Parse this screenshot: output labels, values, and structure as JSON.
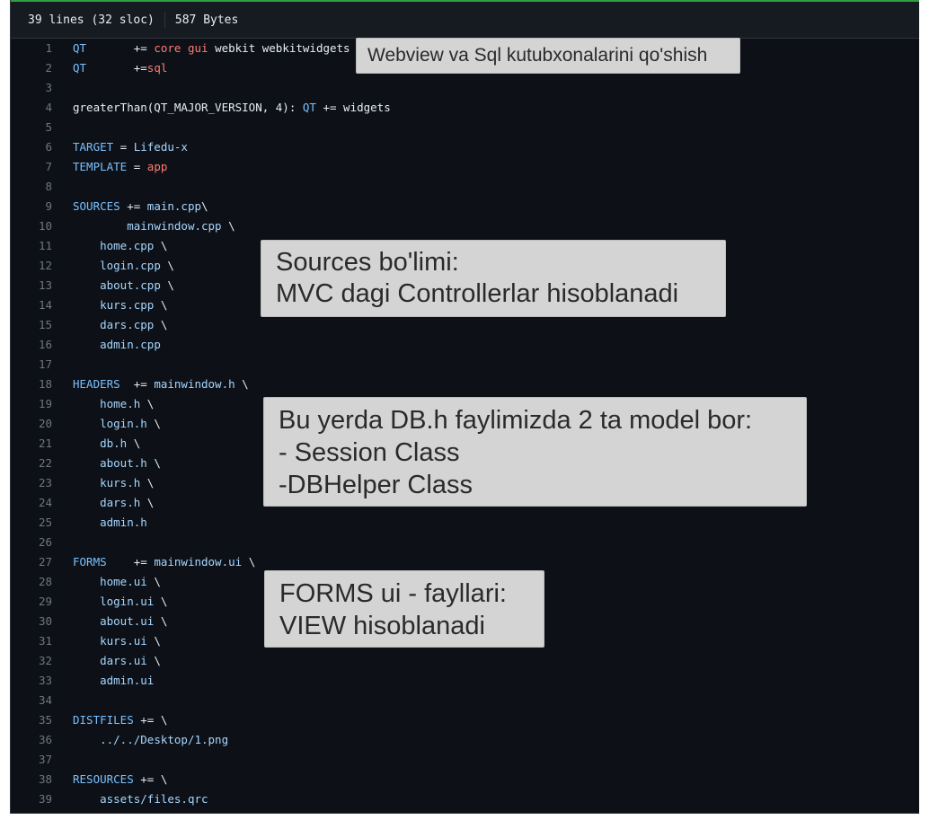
{
  "header": {
    "lines_info": "39 lines (32 sloc)",
    "size": "587 Bytes"
  },
  "code_lines": [
    {
      "n": "1",
      "t": [
        {
          "t": "QT",
          "c": "k"
        },
        {
          "t": "       += "
        },
        {
          "t": "core",
          "c": "r"
        },
        {
          "t": " "
        },
        {
          "t": "gui",
          "c": "r"
        },
        {
          "t": " webkit webkitwidgets"
        }
      ]
    },
    {
      "n": "2",
      "t": [
        {
          "t": "QT",
          "c": "k"
        },
        {
          "t": "       +="
        },
        {
          "t": "sql",
          "c": "r"
        }
      ]
    },
    {
      "n": "3",
      "t": []
    },
    {
      "n": "4",
      "t": [
        {
          "t": "greaterThan(QT_MAJOR_VERSION, 4): "
        },
        {
          "t": "QT",
          "c": "k"
        },
        {
          "t": " += widgets"
        }
      ]
    },
    {
      "n": "5",
      "t": []
    },
    {
      "n": "6",
      "t": [
        {
          "t": "TARGET",
          "c": "k"
        },
        {
          "t": " = "
        },
        {
          "t": "Lifedu-x",
          "c": "a"
        }
      ]
    },
    {
      "n": "7",
      "t": [
        {
          "t": "TEMPLATE",
          "c": "k"
        },
        {
          "t": " = "
        },
        {
          "t": "app",
          "c": "r"
        }
      ]
    },
    {
      "n": "8",
      "t": []
    },
    {
      "n": "9",
      "t": [
        {
          "t": "SOURCES",
          "c": "k"
        },
        {
          "t": " += "
        },
        {
          "t": "main.cpp",
          "c": "a"
        },
        {
          "t": "\\"
        }
      ]
    },
    {
      "n": "10",
      "t": [
        {
          "t": "        "
        },
        {
          "t": "mainwindow.cpp",
          "c": "a"
        },
        {
          "t": " \\"
        }
      ]
    },
    {
      "n": "11",
      "t": [
        {
          "t": "    "
        },
        {
          "t": "home.cpp",
          "c": "a"
        },
        {
          "t": " \\"
        }
      ]
    },
    {
      "n": "12",
      "t": [
        {
          "t": "    "
        },
        {
          "t": "login.cpp",
          "c": "a"
        },
        {
          "t": " \\"
        }
      ]
    },
    {
      "n": "13",
      "t": [
        {
          "t": "    "
        },
        {
          "t": "about.cpp",
          "c": "a"
        },
        {
          "t": " \\"
        }
      ]
    },
    {
      "n": "14",
      "t": [
        {
          "t": "    "
        },
        {
          "t": "kurs.cpp",
          "c": "a"
        },
        {
          "t": " \\"
        }
      ]
    },
    {
      "n": "15",
      "t": [
        {
          "t": "    "
        },
        {
          "t": "dars.cpp",
          "c": "a"
        },
        {
          "t": " \\"
        }
      ]
    },
    {
      "n": "16",
      "t": [
        {
          "t": "    "
        },
        {
          "t": "admin.cpp",
          "c": "a"
        }
      ]
    },
    {
      "n": "17",
      "t": []
    },
    {
      "n": "18",
      "t": [
        {
          "t": "HEADERS",
          "c": "k"
        },
        {
          "t": "  += "
        },
        {
          "t": "mainwindow.h",
          "c": "a"
        },
        {
          "t": " \\"
        }
      ]
    },
    {
      "n": "19",
      "t": [
        {
          "t": "    "
        },
        {
          "t": "home.h",
          "c": "a"
        },
        {
          "t": " \\"
        }
      ]
    },
    {
      "n": "20",
      "t": [
        {
          "t": "    "
        },
        {
          "t": "login.h",
          "c": "a"
        },
        {
          "t": " \\"
        }
      ]
    },
    {
      "n": "21",
      "t": [
        {
          "t": "    "
        },
        {
          "t": "db.h",
          "c": "a"
        },
        {
          "t": " \\"
        }
      ]
    },
    {
      "n": "22",
      "t": [
        {
          "t": "    "
        },
        {
          "t": "about.h",
          "c": "a"
        },
        {
          "t": " \\"
        }
      ]
    },
    {
      "n": "23",
      "t": [
        {
          "t": "    "
        },
        {
          "t": "kurs.h",
          "c": "a"
        },
        {
          "t": " \\"
        }
      ]
    },
    {
      "n": "24",
      "t": [
        {
          "t": "    "
        },
        {
          "t": "dars.h",
          "c": "a"
        },
        {
          "t": " \\"
        }
      ]
    },
    {
      "n": "25",
      "t": [
        {
          "t": "    "
        },
        {
          "t": "admin.h",
          "c": "a"
        }
      ]
    },
    {
      "n": "26",
      "t": []
    },
    {
      "n": "27",
      "t": [
        {
          "t": "FORMS",
          "c": "k"
        },
        {
          "t": "    += "
        },
        {
          "t": "mainwindow.ui",
          "c": "a"
        },
        {
          "t": " \\"
        }
      ]
    },
    {
      "n": "28",
      "t": [
        {
          "t": "    "
        },
        {
          "t": "home.ui",
          "c": "a"
        },
        {
          "t": " \\"
        }
      ]
    },
    {
      "n": "29",
      "t": [
        {
          "t": "    "
        },
        {
          "t": "login.ui",
          "c": "a"
        },
        {
          "t": " \\"
        }
      ]
    },
    {
      "n": "30",
      "t": [
        {
          "t": "    "
        },
        {
          "t": "about.ui",
          "c": "a"
        },
        {
          "t": " \\"
        }
      ]
    },
    {
      "n": "31",
      "t": [
        {
          "t": "    "
        },
        {
          "t": "kurs.ui",
          "c": "a"
        },
        {
          "t": " \\"
        }
      ]
    },
    {
      "n": "32",
      "t": [
        {
          "t": "    "
        },
        {
          "t": "dars.ui",
          "c": "a"
        },
        {
          "t": " \\"
        }
      ]
    },
    {
      "n": "33",
      "t": [
        {
          "t": "    "
        },
        {
          "t": "admin.ui",
          "c": "a"
        }
      ]
    },
    {
      "n": "34",
      "t": []
    },
    {
      "n": "35",
      "t": [
        {
          "t": "DISTFILES",
          "c": "k"
        },
        {
          "t": " += \\"
        }
      ]
    },
    {
      "n": "36",
      "t": [
        {
          "t": "    "
        },
        {
          "t": "../../Desktop/1.png",
          "c": "a"
        }
      ]
    },
    {
      "n": "37",
      "t": []
    },
    {
      "n": "38",
      "t": [
        {
          "t": "RESOURCES",
          "c": "k"
        },
        {
          "t": " += \\"
        }
      ]
    },
    {
      "n": "39",
      "t": [
        {
          "t": "    "
        },
        {
          "t": "assets/files.qrc",
          "c": "a"
        }
      ]
    }
  ],
  "notes": {
    "webview": [
      "Webview va Sql kutubxonalarini qo'shish"
    ],
    "sources": [
      "Sources bo'limi:",
      "MVC dagi Controllerlar hisoblanadi"
    ],
    "headers": [
      "Bu yerda DB.h faylimizda 2 ta model bor:",
      "- Session Class",
      "-DBHelper Class"
    ],
    "forms": [
      "FORMS ui - fayllari:",
      "VIEW hisoblanadi"
    ]
  }
}
